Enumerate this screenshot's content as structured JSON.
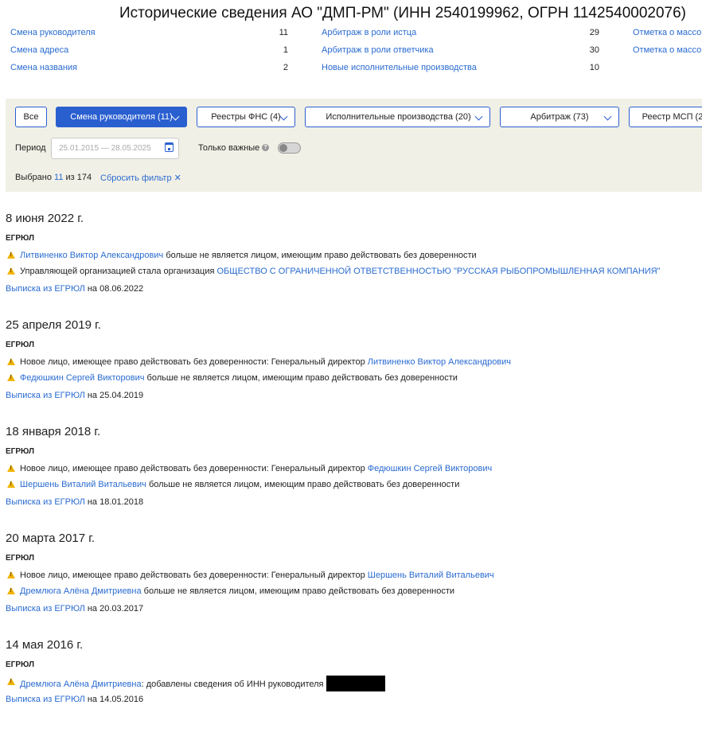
{
  "page_title": "Исторические сведения АО \"ДМП-РМ\" (ИНН 2540199962, ОГРН 1142540002076)",
  "stats": {
    "col1": [
      {
        "label": "Смена руководителя",
        "count": "11"
      },
      {
        "label": "Смена адреса",
        "count": "1"
      },
      {
        "label": "Смена названия",
        "count": "2"
      }
    ],
    "col2": [
      {
        "label": "Арбитраж в роли истца",
        "count": "29"
      },
      {
        "label": "Арбитраж в роли ответчика",
        "count": "30"
      },
      {
        "label": "Новые исполнительные производства",
        "count": "10"
      }
    ],
    "col3": [
      {
        "label": "Отметка о массов"
      },
      {
        "label": "Отметка о массов"
      }
    ]
  },
  "filters": {
    "all": "Все",
    "change_head": "Смена руководителя (11)",
    "fns": "Реестры ФНС (4)",
    "enforcement": "Исполнительные производства (20)",
    "arbitration": "Арбитраж (73)",
    "msp": "Реестр МСП (2"
  },
  "period": {
    "label": "Период",
    "placeholder": "25.01.2015 — 28.05.2025"
  },
  "important": {
    "label": "Только важные",
    "help": "?"
  },
  "selection": {
    "prefix": "Выбрано",
    "count": "11",
    "suffix": "из 174",
    "reset": "Сбросить фильтр",
    "reset_icon": "✕"
  },
  "events": [
    {
      "date": "8 июня 2022 г.",
      "source": "ЕГРЮЛ",
      "items": [
        {
          "pre": "",
          "link": "Литвиненко Виктор Александрович",
          "post": " больше не является лицом, имеющим право действовать без доверенности"
        },
        {
          "pre": "Управляющей организацией стала организация ",
          "link": "ОБЩЕСТВО С ОГРАНИЧЕННОЙ ОТВЕТСТВЕННОСТЬЮ \"РУССКАЯ РЫБОПРОМЫШЛЕННАЯ КОМПАНИЯ\"",
          "post": ""
        }
      ],
      "extract_link": "Выписка из ЕГРЮЛ",
      "extract_date": " на 08.06.2022"
    },
    {
      "date": "25 апреля 2019 г.",
      "source": "ЕГРЮЛ",
      "items": [
        {
          "pre": "Новое лицо, имеющее право действовать без доверенности: Генеральный директор ",
          "link": "Литвиненко Виктор Александрович",
          "post": ""
        },
        {
          "pre": "",
          "link": "Федюшкин Сергей Викторович",
          "post": " больше не является лицом, имеющим право действовать без доверенности"
        }
      ],
      "extract_link": "Выписка из ЕГРЮЛ",
      "extract_date": " на 25.04.2019"
    },
    {
      "date": "18 января 2018 г.",
      "source": "ЕГРЮЛ",
      "items": [
        {
          "pre": "Новое лицо, имеющее право действовать без доверенности: Генеральный директор ",
          "link": "Федюшкин Сергей Викторович",
          "post": ""
        },
        {
          "pre": "",
          "link": "Шершень Виталий Витальевич",
          "post": " больше не является лицом, имеющим право действовать без доверенности"
        }
      ],
      "extract_link": "Выписка из ЕГРЮЛ",
      "extract_date": " на 18.01.2018"
    },
    {
      "date": "20 марта 2017 г.",
      "source": "ЕГРЮЛ",
      "items": [
        {
          "pre": "Новое лицо, имеющее право действовать без доверенности: Генеральный директор ",
          "link": "Шершень Виталий Витальевич",
          "post": ""
        },
        {
          "pre": "",
          "link": "Дремлюга Алёна Дмитриевна",
          "post": " больше не является лицом, имеющим право действовать без доверенности"
        }
      ],
      "extract_link": "Выписка из ЕГРЮЛ",
      "extract_date": " на 20.03.2017"
    },
    {
      "date": "14 мая 2016 г.",
      "source": "ЕГРЮЛ",
      "items": [
        {
          "pre": "",
          "link": "Дремлюга Алёна Дмитриевна",
          "post": ": добавлены сведения об ИНН руководителя",
          "redacted": true
        }
      ],
      "extract_link": "Выписка из ЕГРЮЛ",
      "extract_date": " на 14.05.2016"
    }
  ]
}
